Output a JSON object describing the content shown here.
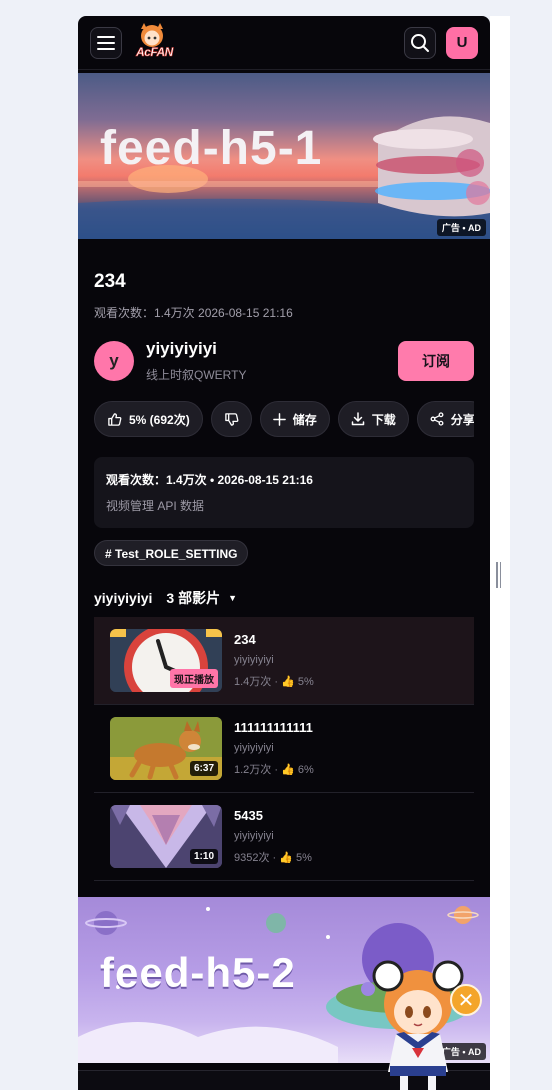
{
  "topbar": {
    "logo": "AcFAN",
    "user_initial": "U"
  },
  "banners": [
    {
      "title": "feed-h5-1",
      "ad_label": "广告 • AD"
    },
    {
      "title": "feed-h5-2",
      "ad_label": "广告 • AD"
    }
  ],
  "video": {
    "title": "234",
    "meta": "观看次数：1.4万次   2026-08-15 21:16"
  },
  "channel": {
    "initial": "y",
    "name": "yiyiyiyiyi",
    "subtitle": "线上时叙QWERTY",
    "subscribe_label": "订阅"
  },
  "actions": {
    "like": "5% (692次)",
    "save": "储存",
    "download": "下载",
    "share": "分享"
  },
  "info_card": {
    "line": "观看次数：1.4万次 • 2026-08-15 21:16",
    "desc": "视频管理 API 数据"
  },
  "tag": "# Test_ROLE_SETTING",
  "playlist": {
    "owner": "yiyiyiyiyi",
    "count": "3 部影片",
    "items": [
      {
        "title": "234",
        "author": "yiyiyiyiyi",
        "views": "1.4万次 · ",
        "likes": "5%",
        "badge": "现正播放"
      },
      {
        "title": "111111111111",
        "author": "yiyiyiyiyi",
        "views": "1.2万次 · ",
        "likes": "6%",
        "badge": "6:37"
      },
      {
        "title": "5435",
        "author": "yiyiyiyiyi",
        "views": "9352次 · ",
        "likes": "5%",
        "badge": "1:10"
      }
    ]
  },
  "colors": {
    "accent": "#ff7bac",
    "background": "#07060b",
    "card": "#15141b"
  }
}
